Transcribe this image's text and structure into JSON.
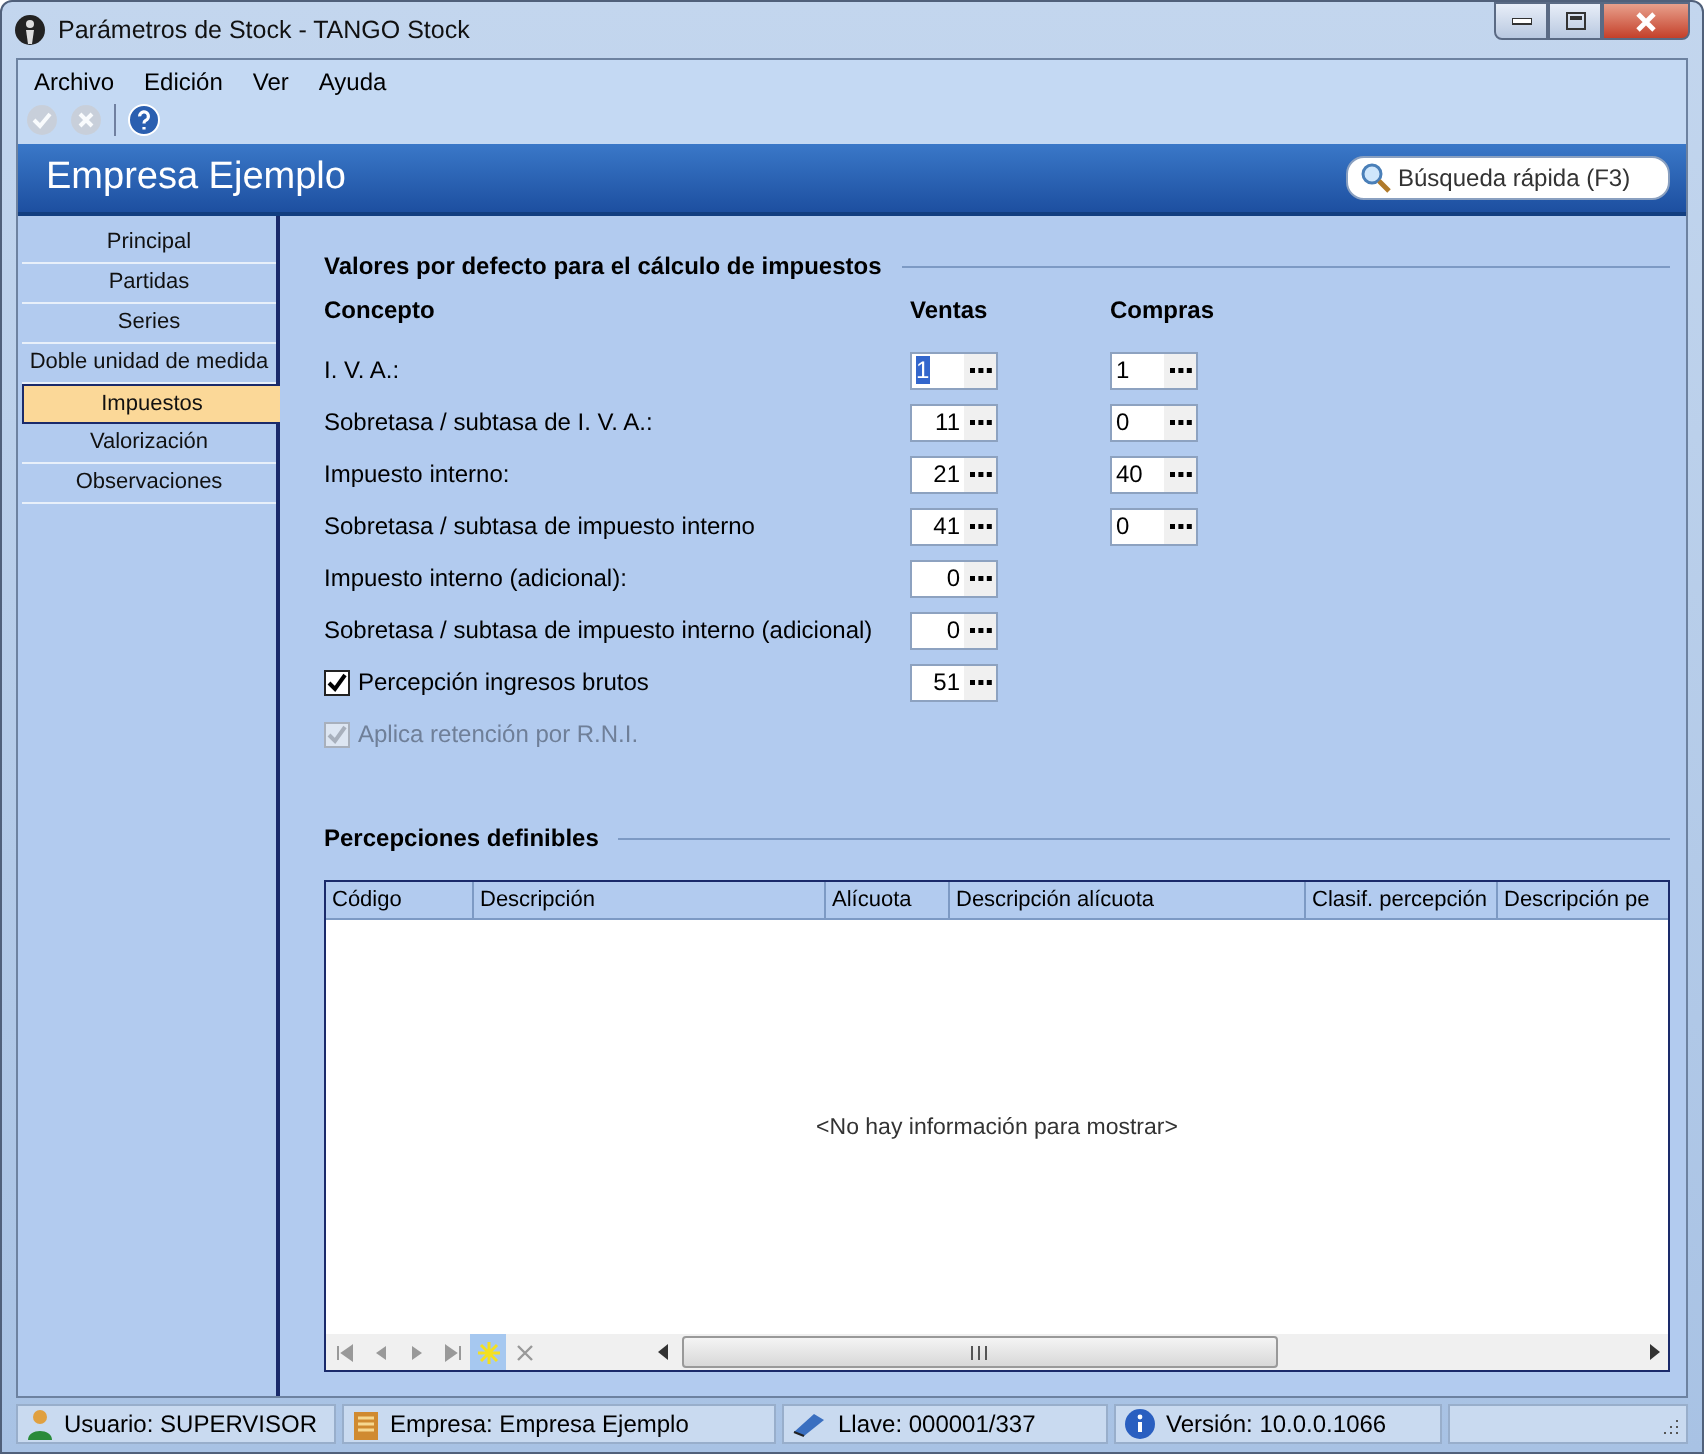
{
  "window": {
    "title": "Parámetros de Stock - TANGO Stock"
  },
  "menu": [
    "Archivo",
    "Edición",
    "Ver",
    "Ayuda"
  ],
  "toolbar": [
    {
      "kind": "accept",
      "disabled": true
    },
    {
      "kind": "cancel",
      "disabled": true
    },
    {
      "kind": "help",
      "disabled": false
    }
  ],
  "header": {
    "title": "Empresa Ejemplo",
    "search": {
      "placeholder": "Búsqueda rápida (F3)"
    }
  },
  "sidebar": {
    "items": [
      {
        "label": "Principal",
        "selected": false
      },
      {
        "label": "Partidas",
        "selected": false
      },
      {
        "label": "Series",
        "selected": false
      },
      {
        "label": "Doble unidad de medida",
        "selected": false
      },
      {
        "label": "Impuestos",
        "selected": true
      },
      {
        "label": "Valorización",
        "selected": false
      },
      {
        "label": "Observaciones",
        "selected": false
      }
    ]
  },
  "defaults": {
    "title": "Valores por defecto para el cálculo de impuestos",
    "columns": [
      "Concepto",
      "Ventas",
      "Compras"
    ],
    "rows": [
      {
        "kind": "text",
        "label": "I. V. A.:",
        "ventas": {
          "value": "1",
          "selected": true
        },
        "compras": {
          "value": "1",
          "selected": false
        }
      },
      {
        "kind": "text",
        "label": "Sobretasa / subtasa de I. V. A.:",
        "ventas": {
          "value": "11",
          "selected": false
        },
        "compras": {
          "value": "0",
          "selected": false
        }
      },
      {
        "kind": "text",
        "label": "Impuesto interno:",
        "ventas": {
          "value": "21",
          "selected": false
        },
        "compras": {
          "value": "40",
          "selected": false
        }
      },
      {
        "kind": "text",
        "label": "Sobretasa / subtasa de impuesto interno",
        "ventas": {
          "value": "41",
          "selected": false
        },
        "compras": {
          "value": "0",
          "selected": false
        }
      },
      {
        "kind": "text",
        "label": "Impuesto interno (adicional):",
        "ventas": {
          "value": "0",
          "selected": false
        }
      },
      {
        "kind": "text",
        "label": "Sobretasa / subtasa de impuesto interno (adicional)",
        "ventas": {
          "value": "0",
          "selected": false
        }
      },
      {
        "kind": "checkbox",
        "label": "Percepción ingresos brutos",
        "checked": true,
        "disabled": false,
        "ventas": {
          "value": "51",
          "selected": false
        }
      },
      {
        "kind": "checkbox",
        "label": "Aplica retención por R.N.I.",
        "checked": true,
        "disabled": true
      }
    ]
  },
  "perceptions": {
    "title": "Percepciones definibles",
    "columns": [
      "Código",
      "Descripción",
      "Alícuota",
      "Descripción alícuota",
      "Clasif. percepción",
      "Descripción pe"
    ],
    "empty_message": "<No hay información para mostrar>",
    "navigator": [
      {
        "kind": "first",
        "disabled": true
      },
      {
        "kind": "prev",
        "disabled": true
      },
      {
        "kind": "next",
        "disabled": true
      },
      {
        "kind": "last",
        "disabled": true
      },
      {
        "kind": "new",
        "disabled": false
      },
      {
        "kind": "delete",
        "disabled": true
      }
    ]
  },
  "status_bar": [
    {
      "kind": "user",
      "text": "Usuario: SUPERVISOR"
    },
    {
      "kind": "company",
      "text": "Empresa: Empresa Ejemplo"
    },
    {
      "kind": "key",
      "text": "Llave: 000001/337"
    },
    {
      "kind": "version",
      "text": "Versión: 10.0.0.1066"
    }
  ]
}
